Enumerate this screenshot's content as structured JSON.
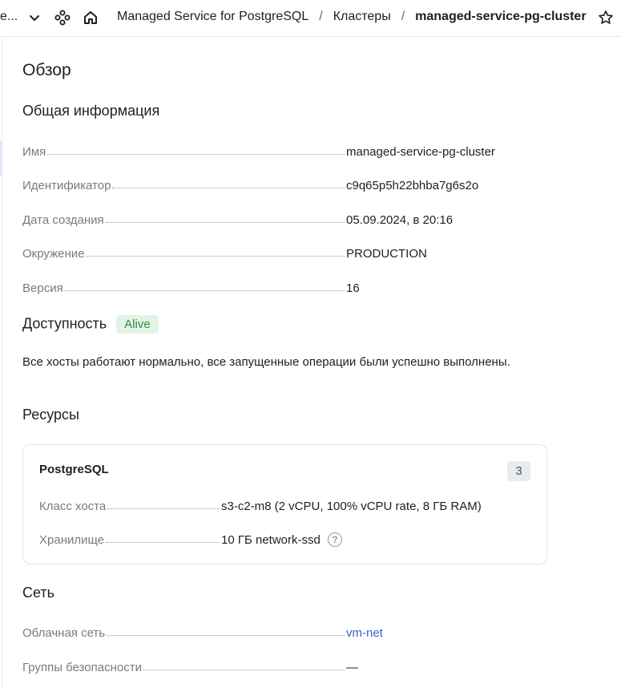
{
  "topbar": {
    "truncated_label": "е...",
    "breadcrumbs": [
      "Managed Service for PostgreSQL",
      "Кластеры",
      "managed-service-pg-cluster"
    ]
  },
  "page": {
    "title": "Обзор"
  },
  "general": {
    "title": "Общая информация",
    "rows": [
      {
        "label": "Имя",
        "value": "managed-service-pg-cluster"
      },
      {
        "label": "Идентификатор",
        "value": "c9q65p5h22bhba7g6s2o"
      },
      {
        "label": "Дата создания",
        "value": "05.09.2024, в 20:16"
      },
      {
        "label": "Окружение",
        "value": "PRODUCTION"
      },
      {
        "label": "Версия",
        "value": "16"
      }
    ]
  },
  "availability": {
    "title": "Доступность",
    "status": "Alive",
    "status_color": "#2e8f3e",
    "description": "Все хосты работают нормально, все запущенные операции были успешно выполнены."
  },
  "resources": {
    "title": "Ресурсы",
    "card": {
      "title": "PostgreSQL",
      "count": "3",
      "rows": [
        {
          "label": "Класс хоста",
          "value": "s3-c2-m8 (2 vCPU, 100% vCPU rate, 8 ГБ RAM)"
        },
        {
          "label": "Хранилище",
          "value": "10 ГБ network-ssd",
          "icon": "help-icon"
        }
      ]
    }
  },
  "network": {
    "title": "Сеть",
    "rows": [
      {
        "label": "Облачная сеть",
        "value": "vm-net"
      },
      {
        "label": "Группы безопасности",
        "value": "—"
      }
    ]
  },
  "icons": {
    "chevron": "chevron-down-icon",
    "services": "services-icon",
    "home": "home-icon",
    "star": "star-icon"
  },
  "colors": {
    "link": "#3a62d1",
    "badge_bg": "#e3f3e5"
  }
}
